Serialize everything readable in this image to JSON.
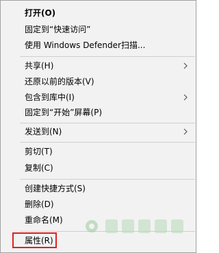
{
  "menu": {
    "items": [
      {
        "label": "打开(O)",
        "bold": true
      },
      {
        "label": "固定到“快速访问”"
      },
      {
        "label": "使用 Windows Defender扫描..."
      },
      {
        "label": "共享(H)",
        "submenu": true
      },
      {
        "label": "还原以前的版本(V)"
      },
      {
        "label": "包含到库中(I)",
        "submenu": true
      },
      {
        "label": "固定到“开始”屏幕(P)"
      },
      {
        "label": "发送到(N)",
        "submenu": true
      },
      {
        "label": "剪切(T)"
      },
      {
        "label": "复制(C)"
      },
      {
        "label": "创建快捷方式(S)"
      },
      {
        "label": "删除(D)"
      },
      {
        "label": "重命名(M)"
      },
      {
        "label": "属性(R)",
        "highlighted": true
      }
    ],
    "highlight_color": "#e02020"
  },
  "watermark": {
    "icon": "watermark-logo"
  }
}
